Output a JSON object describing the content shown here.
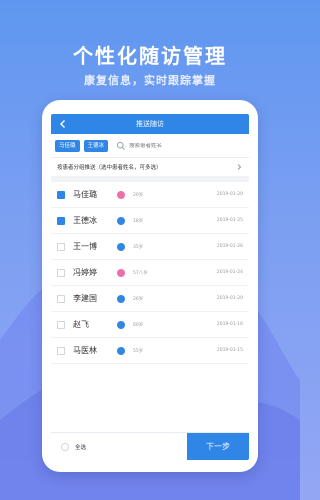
{
  "hero": {
    "title": "个性化随访管理",
    "subtitle": "康复信息，实时跟踪掌握"
  },
  "header": {
    "title": "推送随访",
    "back_icon": "chevron-left-icon"
  },
  "tags": [
    "马佳璐",
    "王德冰"
  ],
  "search": {
    "placeholder": "搜索患者姓名",
    "icon": "search-icon"
  },
  "hint": {
    "text": "按患者分组推送（选中患者姓名，可多选）",
    "icon": "chevron-right-icon"
  },
  "patients": [
    {
      "name": "马佳璐",
      "checked": true,
      "gender": "female",
      "age": "20岁",
      "date": "2019-01-20"
    },
    {
      "name": "王德冰",
      "checked": true,
      "gender": "male",
      "age": "18岁",
      "date": "2019-01-25"
    },
    {
      "name": "王一博",
      "checked": false,
      "gender": "male",
      "age": "35岁",
      "date": "2019-01-26"
    },
    {
      "name": "冯婷婷",
      "checked": false,
      "gender": "female",
      "age": "57八岁",
      "date": "2019-01-24"
    },
    {
      "name": "李建国",
      "checked": false,
      "gender": "male",
      "age": "26岁",
      "date": "2019-01-20"
    },
    {
      "name": "赵飞",
      "checked": false,
      "gender": "male",
      "age": "60岁",
      "date": "2019-01-16"
    },
    {
      "name": "马医林",
      "checked": false,
      "gender": "male",
      "age": "55岁",
      "date": "2019-01-15"
    }
  ],
  "footer": {
    "select_all_label": "全选",
    "next_label": "下一步"
  },
  "colors": {
    "accent": "#2f86e6",
    "female": "#ee6fa7",
    "male": "#2f86e6"
  }
}
